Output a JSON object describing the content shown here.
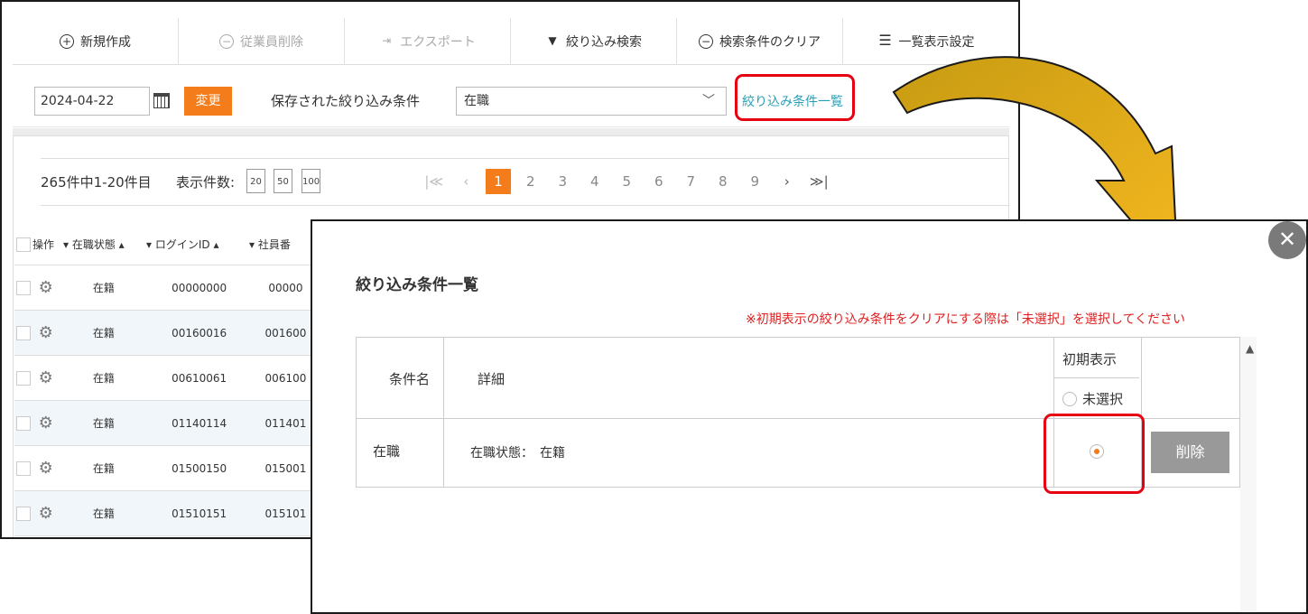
{
  "toolbar": {
    "new": "新規作成",
    "delete_employee": "従業員削除",
    "export": "エクスポート",
    "filter_search": "絞り込み検索",
    "clear_conditions": "検索条件のクリア",
    "list_settings": "一覧表示設定"
  },
  "filter_bar": {
    "date_value": "2024-04-22",
    "change_button": "変更",
    "saved_label": "保存された絞り込み条件",
    "saved_value": "在職",
    "list_link": "絞り込み条件一覧"
  },
  "list": {
    "count_text": "265件中1-20件目",
    "per_page_label": "表示件数:",
    "per_page_options": [
      "20",
      "50",
      "100"
    ],
    "pages": [
      "1",
      "2",
      "3",
      "4",
      "5",
      "6",
      "7",
      "8",
      "9"
    ],
    "current_page": "1",
    "columns": [
      "操作",
      "在職状態",
      "ログインID",
      "社員番"
    ],
    "rows": [
      {
        "status": "在籍",
        "login_id": "00000000",
        "emp_no": "00000"
      },
      {
        "status": "在籍",
        "login_id": "00160016",
        "emp_no": "001600"
      },
      {
        "status": "在籍",
        "login_id": "00610061",
        "emp_no": "006100"
      },
      {
        "status": "在籍",
        "login_id": "01140114",
        "emp_no": "011401"
      },
      {
        "status": "在籍",
        "login_id": "01500150",
        "emp_no": "015001"
      },
      {
        "status": "在籍",
        "login_id": "01510151",
        "emp_no": "015101"
      }
    ]
  },
  "modal": {
    "title": "絞り込み条件一覧",
    "note": "※初期表示の絞り込み条件をクリアにする際は「未選択」を選択してください",
    "headers": {
      "name": "条件名",
      "detail": "詳細",
      "initial_display": "初期表示",
      "unselected": "未選択"
    },
    "rows": [
      {
        "name": "在職",
        "detail": "在職状態：　在籍",
        "delete": "削除"
      }
    ]
  },
  "colors": {
    "accent_orange": "#f47c1a",
    "highlight_red": "#e60012",
    "link_teal": "#2aa0b8",
    "arrow_gold": "#e0a818"
  }
}
